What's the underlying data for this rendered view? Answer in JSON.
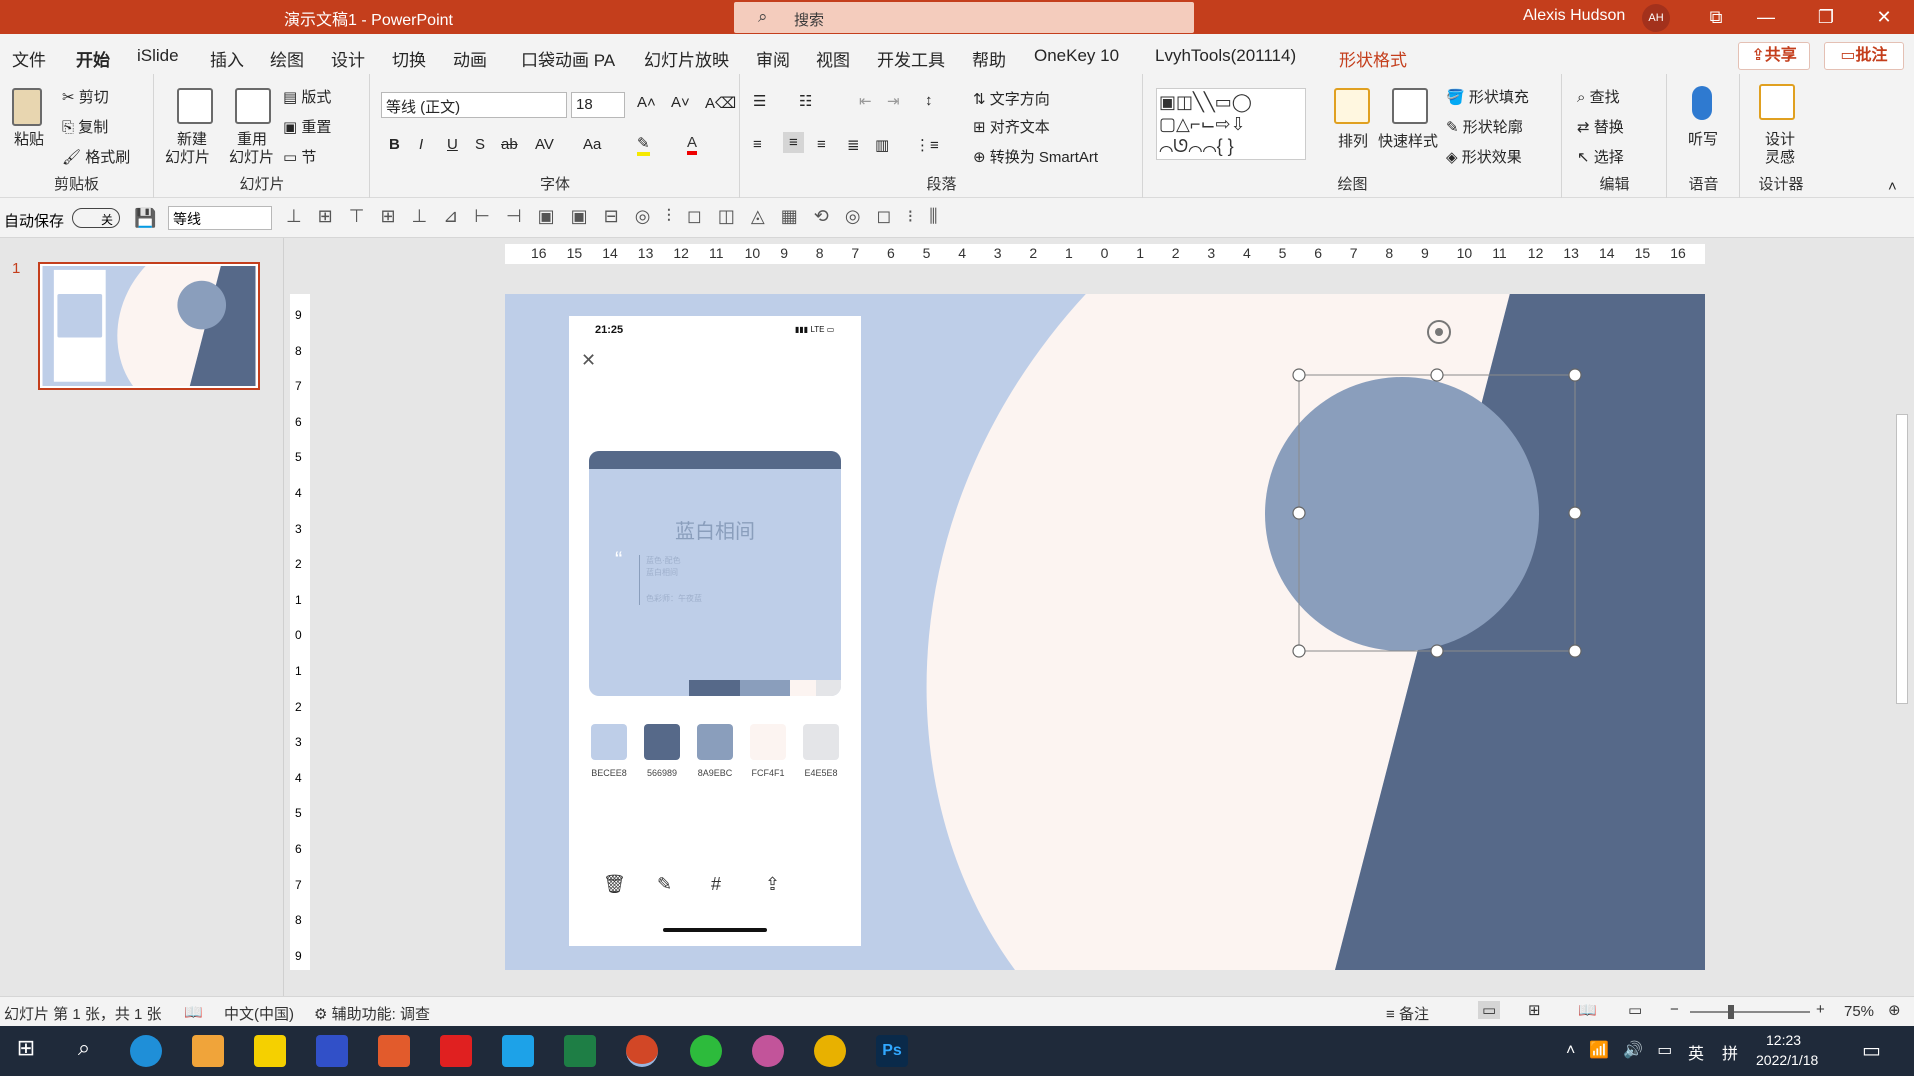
{
  "titlebar": {
    "doc": "演示文稿1",
    "sep": "-",
    "app": "PowerPoint",
    "search_placeholder": "搜索",
    "user": "Alexis Hudson",
    "initials": "AH"
  },
  "tabs": [
    "文件",
    "开始",
    "iSlide",
    "插入",
    "绘图",
    "设计",
    "切换",
    "动画",
    "口袋动画 PA",
    "幻灯片放映",
    "审阅",
    "视图",
    "开发工具",
    "帮助",
    "OneKey 10",
    "LvyhTools(201114)",
    "形状格式"
  ],
  "share": "共享",
  "comment": "批注",
  "ribbon": {
    "clipboard": {
      "paste": "粘贴",
      "cut": "剪切",
      "copy": "复制",
      "format": "格式刷",
      "label": "剪贴板"
    },
    "slides": {
      "new1": "新建",
      "new2": "幻灯片",
      "reuse1": "重用",
      "reuse2": "幻灯片",
      "layout": "版式",
      "reset": "重置",
      "section": "节",
      "label": "幻灯片"
    },
    "font": {
      "name": "等线 (正文)",
      "size": "18",
      "label": "字体"
    },
    "paragraph": {
      "dir": "文字方向",
      "align": "对齐文本",
      "smart": "转换为 SmartArt",
      "label": "段落"
    },
    "drawing": {
      "arrange": "排列",
      "quick1": "快速样式",
      "fill": "形状填充",
      "outline": "形状轮廓",
      "effect": "形状效果",
      "label": "绘图"
    },
    "editing": {
      "find": "查找",
      "replace": "替换",
      "select": "选择",
      "label": "编辑"
    },
    "voice": {
      "dictate": "听写",
      "label": "语音"
    },
    "designer": {
      "d1": "设计",
      "d2": "灵感",
      "label": "设计器"
    }
  },
  "qat": {
    "autosave": "自动保存",
    "off": "关",
    "font": "等线"
  },
  "slide": {
    "time": "21:25",
    "lte": "LTE",
    "card_title": "蓝白相间",
    "quote_l1": "蓝色·配色",
    "quote_l2": "蓝白相间",
    "quote_l3": "色彩师：午夜蓝",
    "swatches": [
      {
        "hex": "#BECEE8",
        "label": "BECEE8"
      },
      {
        "hex": "#566989",
        "label": "566989"
      },
      {
        "hex": "#8A9EBC",
        "label": "8A9EBC"
      },
      {
        "hex": "#FCF4F1",
        "label": "FCF4F1"
      },
      {
        "hex": "#E4E5E8",
        "label": "E4E5E8"
      }
    ]
  },
  "thumbnail_number": "1",
  "ruler_h": [
    "16",
    "15",
    "14",
    "13",
    "12",
    "11",
    "10",
    "9",
    "8",
    "7",
    "6",
    "5",
    "4",
    "3",
    "2",
    "1",
    "0",
    "1",
    "2",
    "3",
    "4",
    "5",
    "6",
    "7",
    "8",
    "9",
    "10",
    "11",
    "12",
    "13",
    "14",
    "15",
    "16"
  ],
  "ruler_v": [
    "9",
    "8",
    "7",
    "6",
    "5",
    "4",
    "3",
    "2",
    "1",
    "0",
    "1",
    "2",
    "3",
    "4",
    "5",
    "6",
    "7",
    "8",
    "9"
  ],
  "status": {
    "slide": "幻灯片 第 1 张，共 1 张",
    "lang": "中文(中国)",
    "access": "辅助功能: 调查",
    "notes": "备注",
    "zoom": "75%"
  },
  "taskbar": {
    "time": "12:23",
    "date": "2022/1/18",
    "ime1": "英",
    "ime2": "拼"
  },
  "colors": {
    "accent": "#c43e1c",
    "slide_bg": "#becee8",
    "cream": "#fcf4f1",
    "navy": "#566989",
    "circle": "#8a9ebc"
  }
}
